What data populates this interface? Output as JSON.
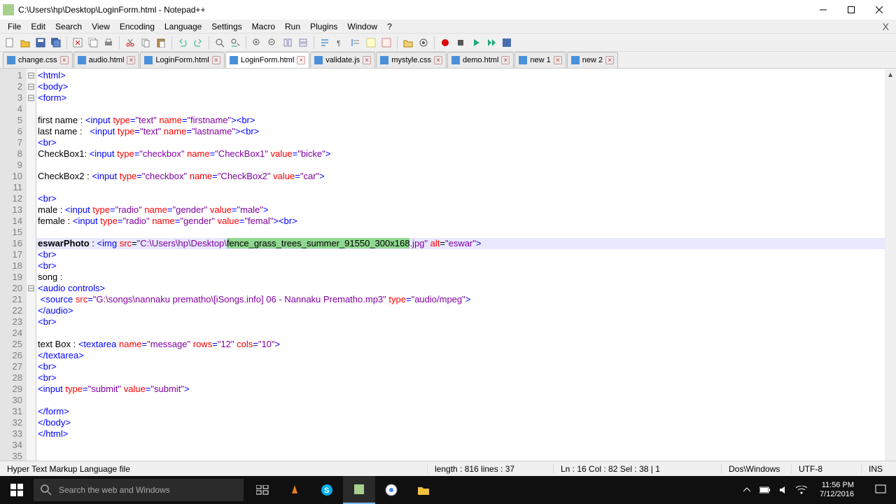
{
  "title": "C:\\Users\\hp\\Desktop\\LoginForm.html - Notepad++",
  "menus": [
    "File",
    "Edit",
    "Search",
    "View",
    "Encoding",
    "Language",
    "Settings",
    "Macro",
    "Run",
    "Plugins",
    "Window",
    "?"
  ],
  "tabs": [
    {
      "label": "change.css"
    },
    {
      "label": "audio.html"
    },
    {
      "label": "LoginForm.html"
    },
    {
      "label": "LoginForm.html",
      "active": true
    },
    {
      "label": "validate.js"
    },
    {
      "label": "mystyle.css"
    },
    {
      "label": "demo.html"
    },
    {
      "label": "new 1"
    },
    {
      "label": "new 2"
    }
  ],
  "status": {
    "lang": "Hyper Text Markup Language file",
    "length": "length : 816    lines : 37",
    "pos": "Ln : 16    Col : 82    Sel : 38 | 1",
    "eol": "Dos\\Windows",
    "enc": "UTF-8",
    "ins": "INS"
  },
  "taskbar": {
    "search_placeholder": "Search the web and Windows",
    "time": "11:56 PM",
    "date": "7/12/2016"
  },
  "code": {
    "selected_text": "fence_grass_trees_summer_91550_300x168",
    "img_path_prefix": "\"C:\\Users\\hp\\Desktop\\",
    "img_path_suffix": ".jpg\"",
    "audio_src": "\"G:\\songs\\nannaku prematho\\[iSongs.info] 06 - Nannaku Prematho.mp3\""
  }
}
